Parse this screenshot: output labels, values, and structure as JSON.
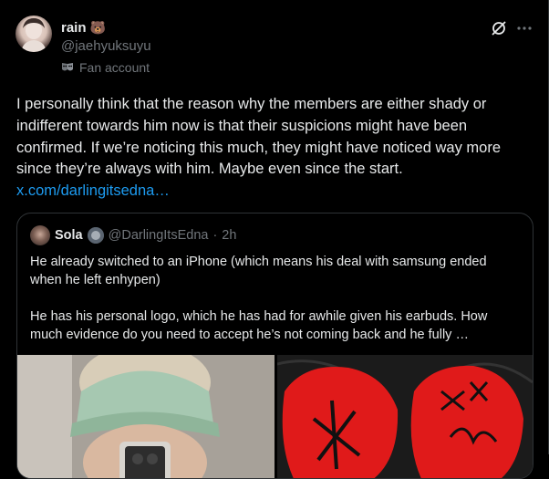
{
  "user": {
    "display_name": "rain",
    "name_emoji": "🐻",
    "handle": "@jaehyuksuyu",
    "account_label": "Fan account",
    "account_icon": "theater-mask-icon"
  },
  "tweet": {
    "text": "I personally think that the reason why the members are either shady or indifferent towards him now is that their suspicions might have been confirmed. If we’re noticing this much, they might have noticed way more since they’re always with him. Maybe even since the start.",
    "link": "x.com/darlingitsedna…"
  },
  "quote": {
    "display_name": "Sola",
    "handle": "@DarlingItsEdna",
    "separator": "·",
    "time": "2h",
    "paragraphs": [
      "He already switched to an iPhone (which means his deal with samsung ended when he left enhypen)",
      "He has his personal logo, which he has had for awhile given his earbuds. How much evidence do you need to accept he’s not coming back and he fully …"
    ]
  },
  "colors": {
    "background": "#000000",
    "text": "#e7e9ea",
    "muted": "#71767b",
    "link": "#1d9bf0",
    "border": "#2f3336"
  }
}
